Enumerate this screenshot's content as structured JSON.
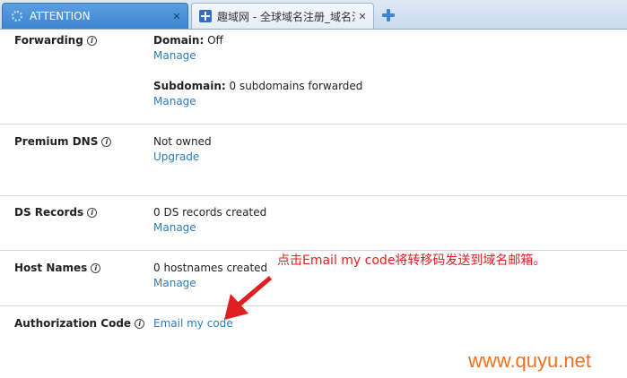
{
  "tabs": [
    {
      "title": "ATTENTION",
      "active": true
    },
    {
      "title": "趣域网 - 全球域名注册_域名注",
      "active": false
    }
  ],
  "rows": {
    "forwarding": {
      "label": "Forwarding",
      "domain_key": "Domain:",
      "domain_val": " Off",
      "domain_link": "Manage",
      "subdomain_key": "Subdomain:",
      "subdomain_val": " 0 subdomains forwarded",
      "subdomain_link": "Manage"
    },
    "premium_dns": {
      "label": "Premium DNS",
      "value": "Not owned",
      "link": "Upgrade"
    },
    "ds_records": {
      "label": "DS Records",
      "value": "0 DS records created",
      "link": "Manage"
    },
    "host_names": {
      "label": "Host Names",
      "value": "0 hostnames created",
      "link": "Manage"
    },
    "auth_code": {
      "label": "Authorization Code",
      "link": "Email my code"
    }
  },
  "annotation": "点击Email my code将转移码发送到域名邮箱。",
  "watermark": "www.quyu.net",
  "colors": {
    "link": "#2b7bbf",
    "annotation": "#e02020",
    "watermark": "#f07020",
    "active_tab": "#3d85d1"
  },
  "icons": {
    "info": "info-icon",
    "loading": "spinner-icon",
    "site": "site-favicon-icon",
    "new_tab": "plus-icon",
    "close": "close-icon"
  }
}
